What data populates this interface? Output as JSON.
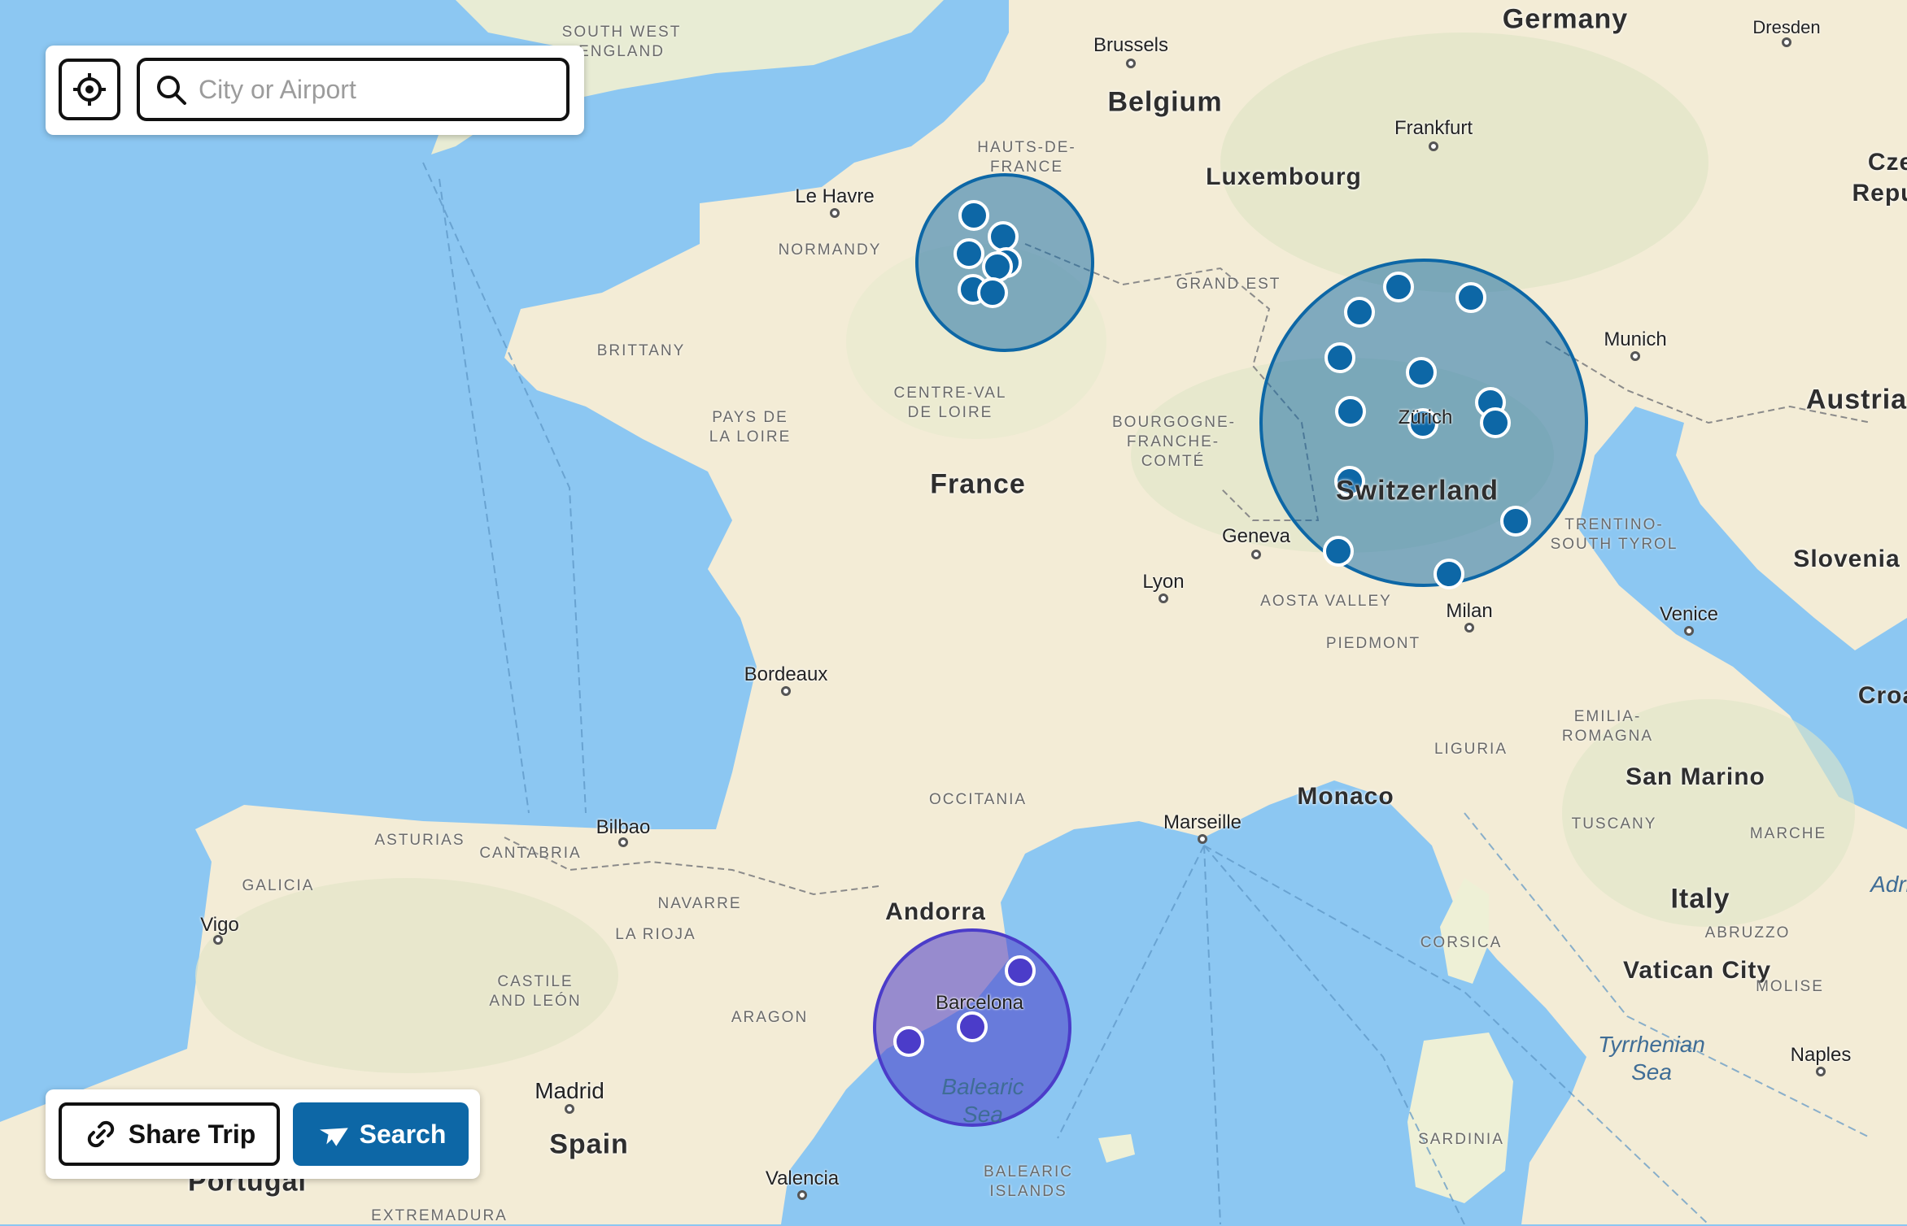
{
  "colors": {
    "ocean": "#8cc7f2",
    "land": "#f3ecd6",
    "cluster_blue": "#0d67a6",
    "cluster_purple": "#4b3cc9",
    "button_primary": "#0d67a6"
  },
  "search": {
    "placeholder": "City or Airport",
    "locate_icon": "crosshair-icon",
    "search_icon": "magnifier-icon"
  },
  "actions": {
    "share_label": "Share Trip",
    "share_icon": "link-icon",
    "search_label": "Search",
    "search_icon": "airplane-icon"
  },
  "map": {
    "countries": [
      {
        "name": "Germany"
      },
      {
        "name": "Belgium"
      },
      {
        "name": "Luxembourg"
      },
      {
        "name": "France"
      },
      {
        "name": "Switzerland"
      },
      {
        "name": "Austria"
      },
      {
        "name": "Slovenia"
      },
      {
        "name": "Croa"
      },
      {
        "name": "Cze"
      },
      {
        "name": "Repu"
      },
      {
        "name": "San Marino"
      },
      {
        "name": "Monaco"
      },
      {
        "name": "Italy"
      },
      {
        "name": "Vatican City"
      },
      {
        "name": "Andorra"
      },
      {
        "name": "Spain"
      },
      {
        "name": "Portugal"
      }
    ],
    "regions": [
      {
        "name": "SOUTH WEST ENGLAND"
      },
      {
        "name": "HAUTS-DE- FRANCE"
      },
      {
        "name": "NORMANDY"
      },
      {
        "name": "GRAND EST"
      },
      {
        "name": "BRITTANY"
      },
      {
        "name": "CENTRE-VAL DE LOIRE"
      },
      {
        "name": "PAYS DE LA LOIRE"
      },
      {
        "name": "BOURGOGNE- FRANCHE- COMTÉ"
      },
      {
        "name": "TRENTINO- SOUTH TYROL"
      },
      {
        "name": "AOSTA VALLEY"
      },
      {
        "name": "PIEDMONT"
      },
      {
        "name": "EMILIA- ROMAGNA"
      },
      {
        "name": "LIGURIA"
      },
      {
        "name": "OCCITANIA"
      },
      {
        "name": "TUSCANY"
      },
      {
        "name": "MARCHE"
      },
      {
        "name": "ASTURIAS"
      },
      {
        "name": "CANTABRIA"
      },
      {
        "name": "GALICIA"
      },
      {
        "name": "NAVARRE"
      },
      {
        "name": "LA RIOJA"
      },
      {
        "name": "CASTILE AND LEÓN"
      },
      {
        "name": "ARAGON"
      },
      {
        "name": "CORSICA"
      },
      {
        "name": "ABRUZZO"
      },
      {
        "name": "MOLISE"
      },
      {
        "name": "SARDINIA"
      },
      {
        "name": "BALEARIC ISLANDS"
      },
      {
        "name": "EXTREMADURA"
      }
    ],
    "cities": [
      {
        "name": "Brussels"
      },
      {
        "name": "Dresden"
      },
      {
        "name": "Frankfurt"
      },
      {
        "name": "Le Havre"
      },
      {
        "name": "Munich"
      },
      {
        "name": "Zürich"
      },
      {
        "name": "Geneva"
      },
      {
        "name": "Lyon"
      },
      {
        "name": "Milan"
      },
      {
        "name": "Venice"
      },
      {
        "name": "Bordeaux"
      },
      {
        "name": "Marseille"
      },
      {
        "name": "Bilbao"
      },
      {
        "name": "Vigo"
      },
      {
        "name": "Barcelona"
      },
      {
        "name": "Madrid"
      },
      {
        "name": "Valencia"
      },
      {
        "name": "Naples"
      }
    ],
    "seas": [
      {
        "name": "Balearic Sea"
      },
      {
        "name": "Tyrrhenian Sea"
      },
      {
        "name": "Adri"
      }
    ],
    "clusters": [
      {
        "name": "paris-area",
        "color": "blue",
        "pin_count": 7
      },
      {
        "name": "switzerland-area",
        "color": "blue",
        "pin_count": 15
      },
      {
        "name": "barcelona-area",
        "color": "purple",
        "pin_count": 3
      }
    ]
  }
}
